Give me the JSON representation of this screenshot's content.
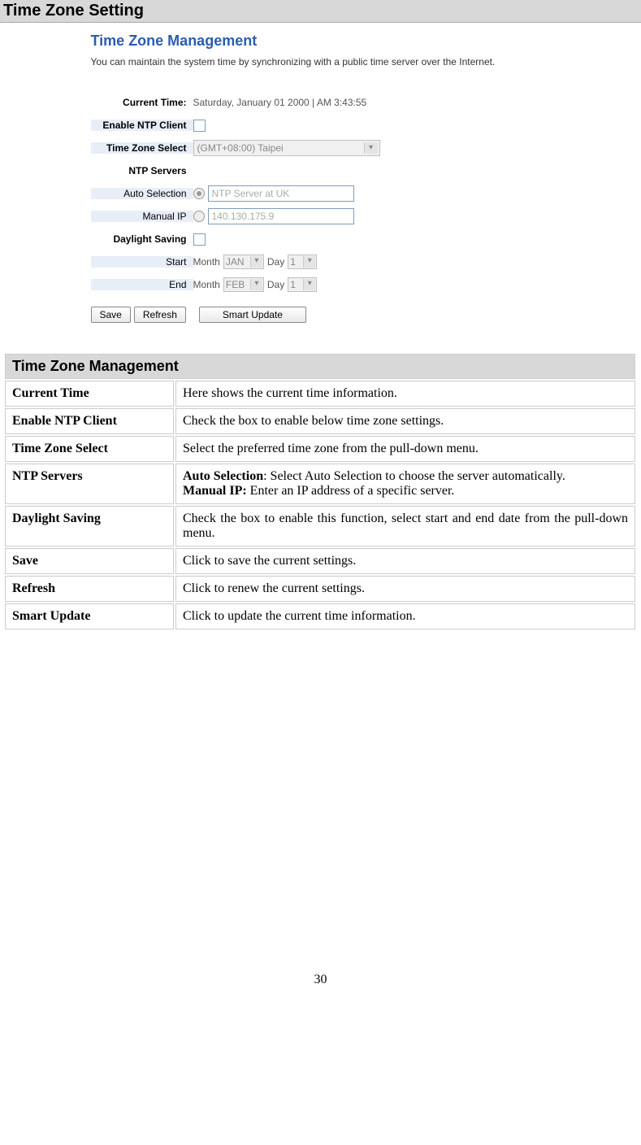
{
  "section": {
    "title": "Time Zone Setting"
  },
  "screenshot": {
    "title": "Time Zone Management",
    "desc": "You can maintain the system time by synchronizing with a public time server over the Internet.",
    "current_time_label": "Current Time:",
    "current_time_value": "Saturday, January 01 2000 | AM 3:43:55",
    "enable_ntp_label": "Enable NTP Client",
    "tz_select_label": "Time Zone Select",
    "tz_select_value": "(GMT+08:00) Taipei",
    "ntp_servers_label": "NTP Servers",
    "auto_sel_label": "Auto Selection",
    "auto_sel_value": "NTP Server at UK",
    "manual_ip_label": "Manual IP",
    "manual_ip_value": "140.130.175.9",
    "daylight_label": "Daylight Saving",
    "start_label": "Start",
    "end_label": "End",
    "month_text": "Month",
    "day_text": "Day",
    "start_month": "JAN",
    "start_day": "1",
    "end_month": "FEB",
    "end_day": "1",
    "btn_save": "Save",
    "btn_refresh": "Refresh",
    "btn_smart": "Smart Update"
  },
  "table": {
    "header": "Time Zone Management",
    "rows": [
      {
        "k": "Current Time",
        "v_plain": "Here shows the current time information."
      },
      {
        "k": "Enable NTP Client",
        "v_plain": "Check the box to enable below time zone settings."
      },
      {
        "k": "Time Zone Select",
        "v_plain": "Select the preferred time zone from the pull-down menu."
      },
      {
        "k": "NTP Servers",
        "b1": "Auto Selection",
        "t1": ": Select Auto Selection to choose the server automatically.",
        "b2": "Manual IP:",
        "t2": " Enter an IP address of a specific server."
      },
      {
        "k": "Daylight Saving",
        "v_plain": "Check the box to enable this function, select start and end date from the pull-down menu."
      },
      {
        "k": "Save",
        "v_plain": "Click to save the current settings."
      },
      {
        "k": "Refresh",
        "v_plain": "Click to renew the current settings."
      },
      {
        "k": "Smart Update",
        "v_plain": "Click to update the current time information."
      }
    ]
  },
  "page_number": "30"
}
